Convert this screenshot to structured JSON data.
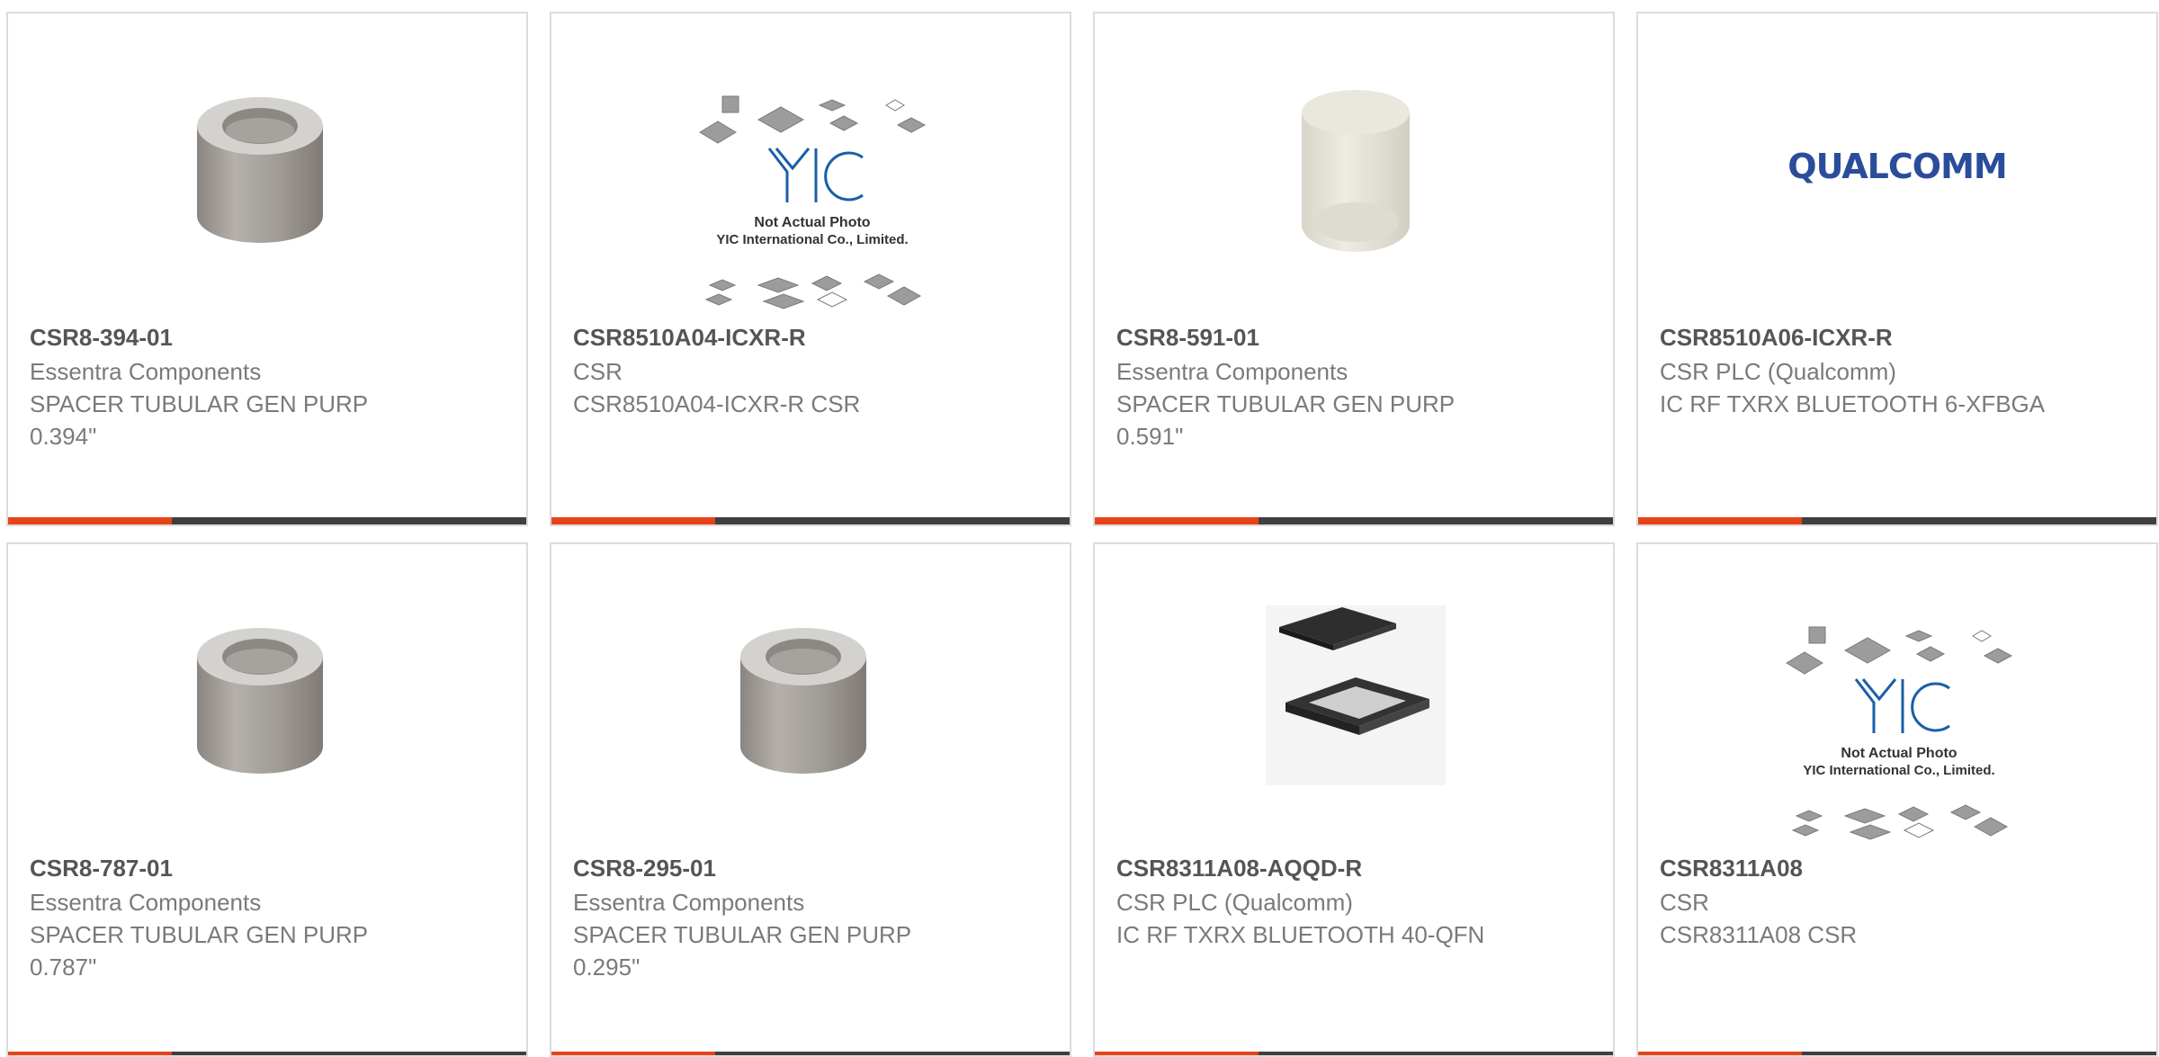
{
  "products": [
    {
      "part_number": "CSR8-394-01",
      "manufacturer": "Essentra Components",
      "description": "SPACER TUBULAR GEN PURP 0.394\"",
      "image": "spacer-gray"
    },
    {
      "part_number": "CSR8510A04-ICXR-R",
      "manufacturer": "CSR",
      "description": "CSR8510A04-ICXR-R CSR",
      "image": "yic-placeholder",
      "image_text": [
        "Not Actual Photo",
        "YIC International Co., Limited."
      ],
      "image_logo": "YIC"
    },
    {
      "part_number": "CSR8-591-01",
      "manufacturer": "Essentra Components",
      "description": "SPACER TUBULAR GEN PURP 0.591\"",
      "image": "spacer-white"
    },
    {
      "part_number": "CSR8510A06-ICXR-R",
      "manufacturer": "CSR PLC (Qualcomm)",
      "description": "IC RF TXRX BLUETOOTH 6-XFBGA",
      "image": "qualcomm-logo",
      "image_logo": "QUALCOMM"
    },
    {
      "part_number": "CSR8-787-01",
      "manufacturer": "Essentra Components",
      "description": "SPACER TUBULAR GEN PURP 0.787\"",
      "image": "spacer-gray"
    },
    {
      "part_number": "CSR8-295-01",
      "manufacturer": "Essentra Components",
      "description": "SPACER TUBULAR GEN PURP 0.295\"",
      "image": "spacer-gray"
    },
    {
      "part_number": "CSR8311A08-AQQD-R",
      "manufacturer": "CSR PLC (Qualcomm)",
      "description": "IC RF TXRX BLUETOOTH 40-QFN",
      "image": "qfn-chip"
    },
    {
      "part_number": "CSR8311A08",
      "manufacturer": "CSR",
      "description": "CSR8311A08 CSR",
      "image": "yic-placeholder",
      "image_text": [
        "Not Actual Photo",
        "YIC International Co., Limited."
      ],
      "image_logo": "YIC"
    }
  ],
  "colors": {
    "accent": "#e84318",
    "bar": "#3f3f3f",
    "border": "#dcdcdc",
    "title": "#555555",
    "text": "#7a7a7a",
    "qualcomm": "#2a4d9b",
    "yic": "#1a5fa8"
  }
}
